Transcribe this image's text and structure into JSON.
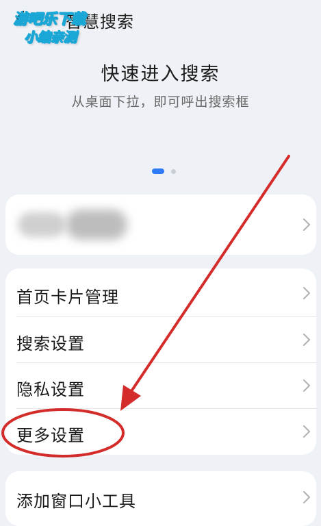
{
  "header": {
    "back_icon": "arrow-left-icon",
    "title": "智慧搜索"
  },
  "watermark": {
    "line1": "游吧乐下载",
    "line2": "小编亲测"
  },
  "hero": {
    "title": "快速进入搜索",
    "subtitle": "从桌面下拉，即可呼出搜索框",
    "pager": {
      "pages": 2,
      "active": 1,
      "active_color": "#2f7cf6"
    }
  },
  "account_card": {
    "content": "blurred",
    "chevron_icon": "chevron-right-icon"
  },
  "settings": {
    "items": [
      {
        "label": "首页卡片管理"
      },
      {
        "label": "搜索设置"
      },
      {
        "label": "隐私设置"
      },
      {
        "label": "更多设置",
        "highlighted": true
      }
    ]
  },
  "widget": {
    "label": "添加窗口小工具"
  },
  "annotation": {
    "color": "#d42b2b",
    "target": "更多设置"
  }
}
